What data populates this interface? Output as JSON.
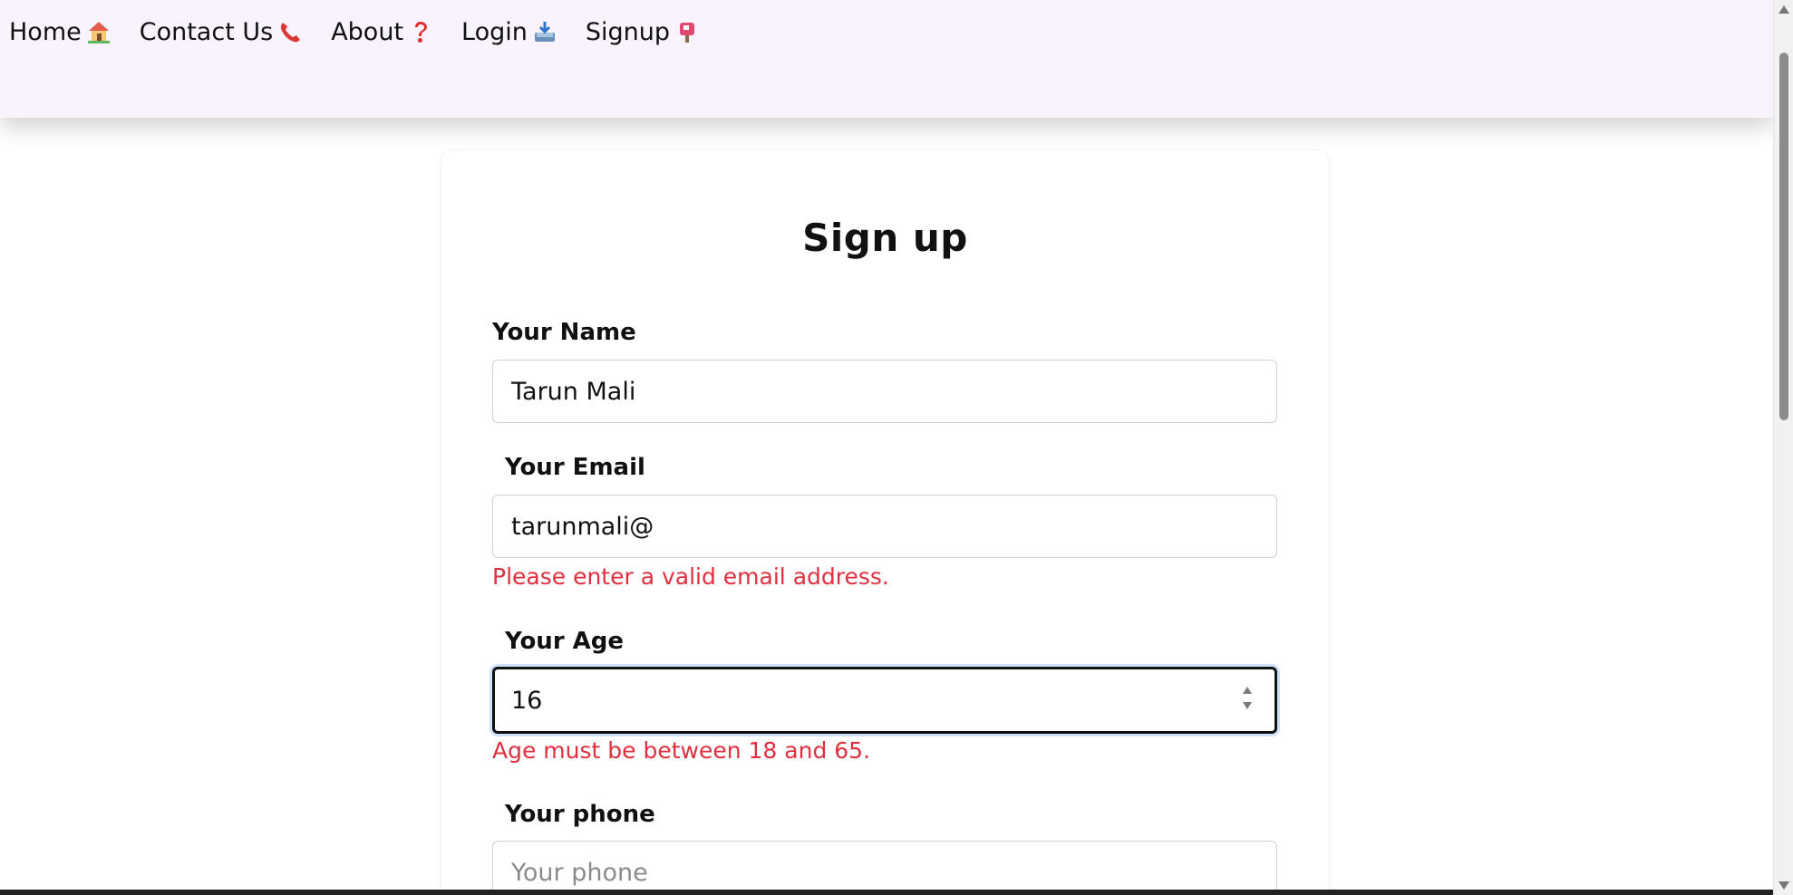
{
  "nav": {
    "items": [
      {
        "label": "Home",
        "icon": "house-icon"
      },
      {
        "label": "Contact Us",
        "icon": "phone-icon"
      },
      {
        "label": "About",
        "icon": "question-icon"
      },
      {
        "label": "Login",
        "icon": "inbox-icon"
      },
      {
        "label": "Signup",
        "icon": "mailbox-icon"
      }
    ]
  },
  "form": {
    "title": "Sign up",
    "name": {
      "label": "Your Name",
      "value": "Tarun Mali"
    },
    "email": {
      "label": "Your Email",
      "value": "tarunmali@",
      "error": "Please enter a valid email address."
    },
    "age": {
      "label": "Your Age",
      "value": "16",
      "error": "Age must be between 18 and 65."
    },
    "phone": {
      "label": "Your phone",
      "placeholder": "Your phone",
      "value": ""
    }
  },
  "colors": {
    "nav_background": "#f9f3fe",
    "error": "#e02f3e",
    "focus_ring": "#cfe0fb"
  }
}
